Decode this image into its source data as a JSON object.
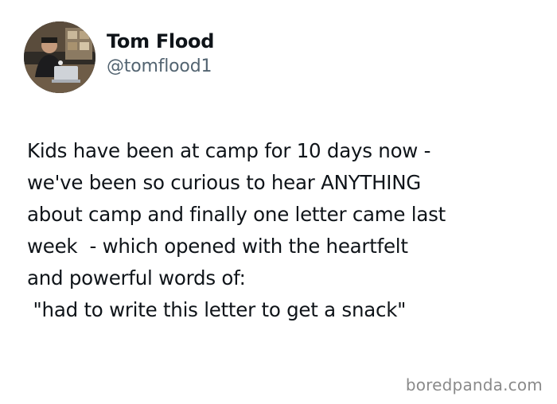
{
  "author": {
    "display_name": "Tom Flood",
    "handle": "@tomflood1"
  },
  "tweet": {
    "lines": [
      "Kids have been at camp for 10 days now -",
      "we've been so curious to hear ANYTHING",
      "about camp and finally one letter came last",
      "week  - which opened with the heartfelt",
      "and powerful words of:",
      " \"had to write this letter to get a snack\""
    ]
  },
  "watermark": "boredpanda.com"
}
